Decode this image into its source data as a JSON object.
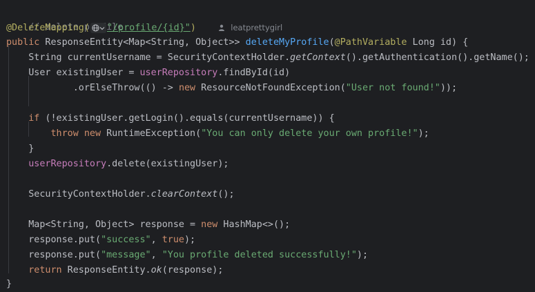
{
  "code": {
    "comment": "// delete profile",
    "annotation": "@DeleteMapping(",
    "mapping_path": "\"/profile/{id}\"",
    "annotation_close": ")",
    "author": "leatprettygirl",
    "sig_public": "public",
    "sig_return": " ResponseEntity<Map<String, Object>> ",
    "sig_method": "deleteMyProfile",
    "sig_paren": "(",
    "sig_pathvar": "@PathVariable",
    "sig_rest": " Long id) {",
    "l3_a": "String currentUsername = SecurityContextHolder.",
    "l3_getcontext": "getContext",
    "l3_b": "().getAuthentication().getName();",
    "l4_a": "User existingUser = ",
    "l4_repo": "userRepository",
    "l4_b": ".findById(id)",
    "l5_a": ".orElseThrow(() -> ",
    "l5_new": "new",
    "l5_b": " ResourceNotFoundException(",
    "l5_str": "\"User not found!\"",
    "l5_c": "));",
    "l7_if": "if",
    "l7_rest": " (!existingUser.getLogin().equals(currentUsername)) {",
    "l8_throw": "throw",
    "l8_new": "new",
    "l8_a": " RuntimeException(",
    "l8_str": "\"You can only delete your own profile!\"",
    "l8_b": ");",
    "l9": "}",
    "l10_repo": "userRepository",
    "l10_b": ".delete(existingUser);",
    "l12_a": "SecurityContextHolder.",
    "l12_clear": "clearContext",
    "l12_b": "();",
    "l14_a": "Map<String, Object> response = ",
    "l14_new": "new",
    "l14_b": " HashMap<>();",
    "l15_a": "response.put(",
    "l15_str": "\"success\"",
    "l15_b": ", ",
    "l15_true": "true",
    "l15_c": ");",
    "l16_a": "response.put(",
    "l16_str1": "\"message\"",
    "l16_b": ", ",
    "l16_str2": "\"You profile deleted successfully!\"",
    "l16_c": ");",
    "l17_return": "return",
    "l17_a": " ResponseEntity.",
    "l17_ok": "ok",
    "l17_b": "(response);",
    "l18": "}"
  },
  "colors": {
    "background": "#1e1f22",
    "keyword": "#cf8e6d",
    "string": "#6aab73",
    "annotation": "#b3ae60",
    "field": "#c77dbb",
    "method": "#56a8f5",
    "comment": "#7a7e85"
  },
  "icons": {
    "inlay": "globe-icon",
    "chevron": "chevron-down-icon",
    "author": "user-icon"
  }
}
